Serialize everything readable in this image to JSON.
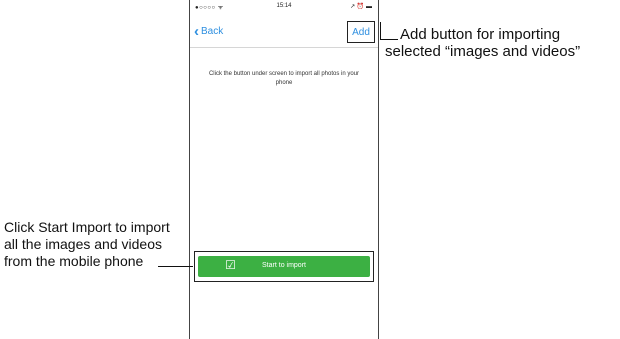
{
  "status_bar": {
    "signal": "●○○○○ ᯤ",
    "time": "15:14",
    "icons": "↗ ⏰ ▬"
  },
  "nav": {
    "back_label": "Back",
    "add_label": "Add"
  },
  "instruction": "Click the button under screen to import all photos in your phone",
  "start_button": {
    "label": "Start to import",
    "icon": "checkbox-icon"
  },
  "callouts": {
    "add_line1": "Add button for importing",
    "add_line2": "selected  “images and videos”",
    "start": "Click Start Import to import all the images and videos from the mobile phone"
  },
  "colors": {
    "accent_blue": "#2e8fe0",
    "button_green": "#3cb043"
  }
}
